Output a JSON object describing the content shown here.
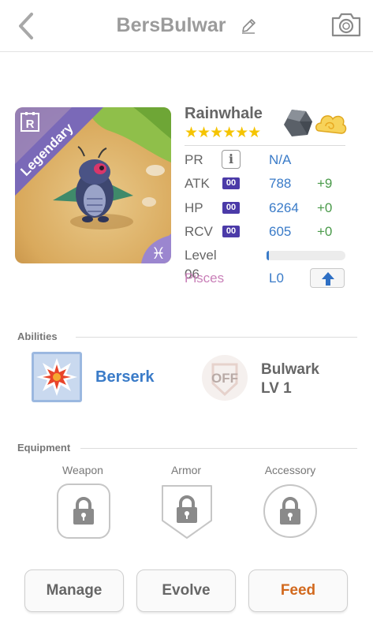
{
  "header": {
    "title": "BersBulwar",
    "back_icon": "chevron-left-icon",
    "edit_icon": "pencil-icon",
    "camera_icon": "camera-icon"
  },
  "monster": {
    "name": "Rainwhale",
    "rarity": "Legendary",
    "rarity_badge": "R",
    "stars": "★★★★★★",
    "star_count": 6,
    "zodiac_symbol": "♓",
    "colors": {
      "legendary_banner": "#8e7cc8",
      "stat_badge": "#4b3aa8",
      "value_blue": "#3a7bc8",
      "plus_green": "#4a9a4a",
      "pisces_pink": "#c97fb8",
      "feed_orange": "#d2691e"
    }
  },
  "stats": {
    "pr": {
      "label": "PR",
      "value": "N/A"
    },
    "atk": {
      "label": "ATK",
      "badge": "00",
      "value": "788",
      "plus": "+9"
    },
    "hp": {
      "label": "HP",
      "badge": "00",
      "value": "6264",
      "plus": "+0"
    },
    "rcv": {
      "label": "RCV",
      "badge": "00",
      "value": "605",
      "plus": "+0"
    },
    "level": {
      "label": "Level 06",
      "progress": 0.02
    },
    "sign": {
      "label": "Pisces",
      "value": "L0"
    }
  },
  "abilities": {
    "section_title": "Abilities",
    "first": {
      "name": "Berserk"
    },
    "second": {
      "status": "OFF",
      "name_line1": "Bulwark",
      "name_line2": "LV 1"
    }
  },
  "equipment": {
    "section_title": "Equipment",
    "slots": [
      {
        "label": "Weapon"
      },
      {
        "label": "Armor"
      },
      {
        "label": "Accessory"
      }
    ]
  },
  "buttons": {
    "manage": "Manage",
    "evolve": "Evolve",
    "feed": "Feed"
  }
}
